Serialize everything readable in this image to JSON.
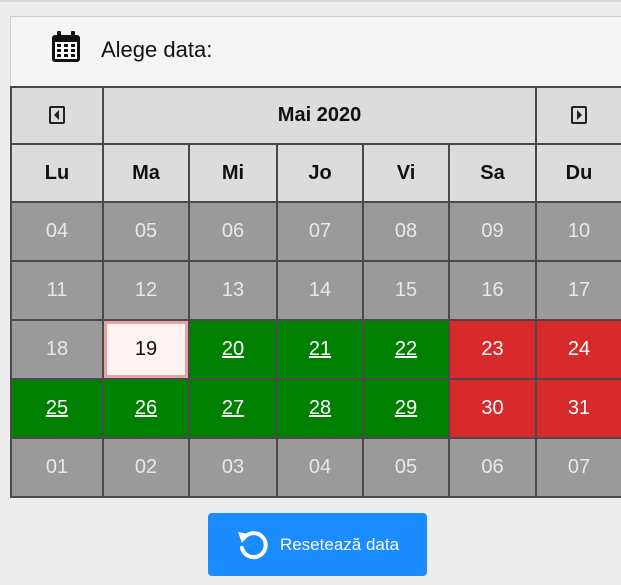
{
  "header": {
    "title": "Alege data:",
    "icon": "calendar-icon"
  },
  "nav": {
    "prev_icon": "caret-left-icon",
    "next_icon": "caret-right-icon",
    "month": "Mai 2020"
  },
  "weekdays": [
    "Lu",
    "Ma",
    "Mi",
    "Jo",
    "Vi",
    "Sa",
    "Du"
  ],
  "weeks": [
    [
      {
        "d": "04",
        "s": "past"
      },
      {
        "d": "05",
        "s": "past"
      },
      {
        "d": "06",
        "s": "past"
      },
      {
        "d": "07",
        "s": "past"
      },
      {
        "d": "08",
        "s": "past"
      },
      {
        "d": "09",
        "s": "past"
      },
      {
        "d": "10",
        "s": "past"
      }
    ],
    [
      {
        "d": "11",
        "s": "past"
      },
      {
        "d": "12",
        "s": "past"
      },
      {
        "d": "13",
        "s": "past"
      },
      {
        "d": "14",
        "s": "past"
      },
      {
        "d": "15",
        "s": "past"
      },
      {
        "d": "16",
        "s": "past"
      },
      {
        "d": "17",
        "s": "past"
      }
    ],
    [
      {
        "d": "18",
        "s": "past"
      },
      {
        "d": "19",
        "s": "today"
      },
      {
        "d": "20",
        "s": "avail"
      },
      {
        "d": "21",
        "s": "avail"
      },
      {
        "d": "22",
        "s": "avail"
      },
      {
        "d": "23",
        "s": "booked"
      },
      {
        "d": "24",
        "s": "booked"
      }
    ],
    [
      {
        "d": "25",
        "s": "avail"
      },
      {
        "d": "26",
        "s": "avail"
      },
      {
        "d": "27",
        "s": "avail"
      },
      {
        "d": "28",
        "s": "avail"
      },
      {
        "d": "29",
        "s": "avail"
      },
      {
        "d": "30",
        "s": "booked"
      },
      {
        "d": "31",
        "s": "booked"
      }
    ],
    [
      {
        "d": "01",
        "s": "other"
      },
      {
        "d": "02",
        "s": "other"
      },
      {
        "d": "03",
        "s": "other"
      },
      {
        "d": "04",
        "s": "other"
      },
      {
        "d": "05",
        "s": "other"
      },
      {
        "d": "06",
        "s": "other"
      },
      {
        "d": "07",
        "s": "other"
      }
    ]
  ],
  "footer": {
    "reset_label": "Resetează data",
    "icon": "reset-icon"
  },
  "colors": {
    "available": "#008000",
    "booked": "#d82a2a",
    "past": "#9a9a9a",
    "today": "#fff2f2",
    "button": "#1a8cff"
  }
}
